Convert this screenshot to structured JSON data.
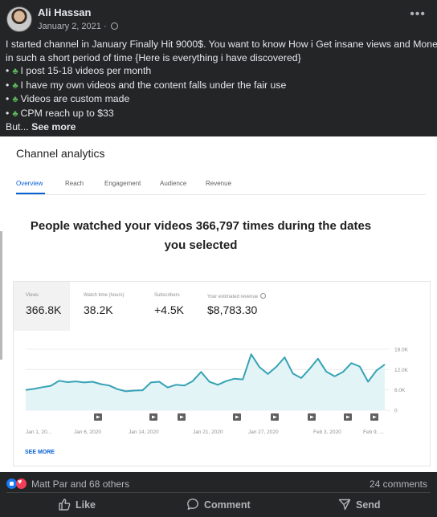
{
  "post": {
    "author": "Ali Hassan",
    "date": "January 2, 2021 ·",
    "body_line1": "I started channel in January Finally Hit 9000$. You want to know How i Get insane views and Money",
    "body_line2": "in such a short period of time {Here is everything i have discovered}",
    "bullets": [
      "I post 15-18 videos per month",
      "I have my own videos and the content falls under the fair use",
      "Videos are custom made",
      "CPM reach up to $33"
    ],
    "truncation": "But...",
    "see_more": "See more"
  },
  "analytics": {
    "title": "Channel analytics",
    "tabs": [
      "Overview",
      "Reach",
      "Engagement",
      "Audience",
      "Revenue"
    ],
    "active_tab": "Overview",
    "headline_line1": "People watched your videos 366,797 times during the dates",
    "headline_line2": "you selected",
    "metrics": [
      {
        "label": "Views",
        "value": "366.8K"
      },
      {
        "label": "Watch time (hours)",
        "value": "38.2K"
      },
      {
        "label": "Subscribers",
        "value": "+4.5K"
      },
      {
        "label": "Your estimated revenue",
        "value": "$8,783.30"
      }
    ],
    "see_more": "SEE MORE",
    "colors": {
      "accent": "#065fd4",
      "line": "#36a3b5",
      "fill": "#e3f4f7"
    }
  },
  "chart_data": {
    "type": "area",
    "x_tick_labels": [
      "Jan 1, 20...",
      "Jan 6, 2020",
      "Jan 14, 2020",
      "Jan 21, 2020",
      "Jan 27, 2020",
      "Feb 3, 2020",
      "Feb 9, ..."
    ],
    "y_tick_labels": [
      "18.0K",
      "12.0K",
      "6.0K",
      "0"
    ],
    "ylim": [
      0,
      18000
    ],
    "grid": true,
    "series": [
      {
        "values": [
          6000,
          6300,
          6800,
          7200,
          8700,
          8300,
          8500,
          8200,
          8400,
          7700,
          7300,
          6200,
          5600,
          5800,
          5900,
          8200,
          8400,
          6700,
          7500,
          7300,
          8600,
          11300,
          8400,
          7500,
          8600,
          9300,
          9100,
          16500,
          12700,
          10700,
          12800,
          15600,
          10800,
          9500,
          12200,
          15200,
          11400,
          10000,
          11300,
          13900,
          12900,
          8400,
          11700,
          13500
        ]
      }
    ]
  },
  "reactions": {
    "text": "Matt Par and 68 others",
    "comments": "24 comments"
  },
  "actions": {
    "like": "Like",
    "comment": "Comment",
    "send": "Send"
  }
}
